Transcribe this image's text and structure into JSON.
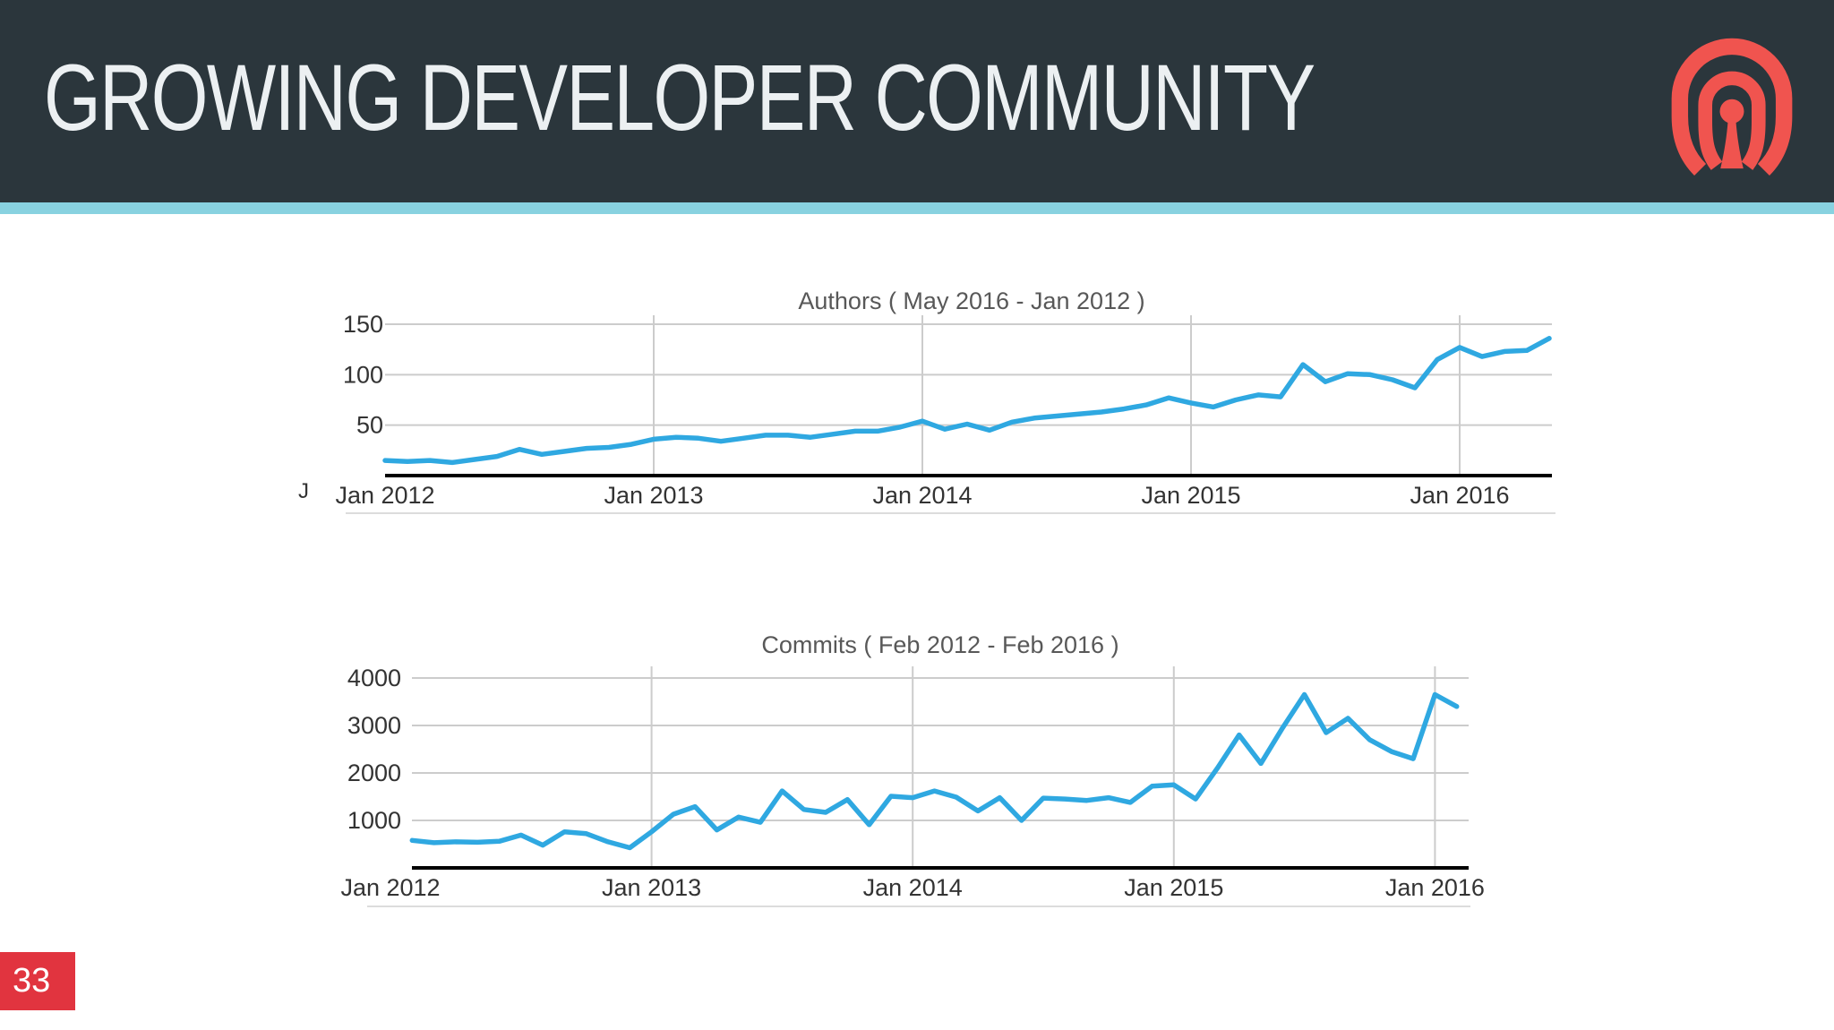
{
  "header": {
    "title": "GROWING DEVELOPER COMMUNITY"
  },
  "footer": {
    "page_number": "33"
  },
  "colors": {
    "header_bg": "#2B363C",
    "accent_teal": "#88D2E0",
    "page_badge_red": "#E1343F",
    "logo_coral": "#F0544F",
    "line_blue": "#2FA8E1",
    "gridline": "#CCCCCC",
    "axis": "#000000",
    "tick_text": "#333333",
    "chart_title_text": "#585858"
  },
  "chart_data": [
    {
      "type": "line",
      "title": "Authors ( May 2016 - Jan 2012 )",
      "xlabel": "",
      "ylabel": "",
      "grid": true,
      "legend": "none",
      "line_color": "#2FA8E1",
      "ylim": [
        0,
        158
      ],
      "y_ticks": [
        50,
        100,
        150
      ],
      "x_tick_labels": [
        "Jan 2012",
        "Jan 2013",
        "Jan 2014",
        "Jan 2015",
        "Jan 2016"
      ],
      "x_tick_data_indices": [
        0,
        12,
        24,
        36,
        48
      ],
      "stray_axis_label": "J",
      "x": [
        "Jan 2012",
        "Feb 2012",
        "Mar 2012",
        "Apr 2012",
        "May 2012",
        "Jun 2012",
        "Jul 2012",
        "Aug 2012",
        "Sep 2012",
        "Oct 2012",
        "Nov 2012",
        "Dec 2012",
        "Jan 2013",
        "Feb 2013",
        "Mar 2013",
        "Apr 2013",
        "May 2013",
        "Jun 2013",
        "Jul 2013",
        "Aug 2013",
        "Sep 2013",
        "Oct 2013",
        "Nov 2013",
        "Dec 2013",
        "Jan 2014",
        "Feb 2014",
        "Mar 2014",
        "Apr 2014",
        "May 2014",
        "Jun 2014",
        "Jul 2014",
        "Aug 2014",
        "Sep 2014",
        "Oct 2014",
        "Nov 2014",
        "Dec 2014",
        "Jan 2015",
        "Feb 2015",
        "Mar 2015",
        "Apr 2015",
        "May 2015",
        "Jun 2015",
        "Jul 2015",
        "Aug 2015",
        "Sep 2015",
        "Oct 2015",
        "Nov 2015",
        "Dec 2015",
        "Jan 2016",
        "Feb 2016",
        "Mar 2016",
        "Apr 2016",
        "May 2016"
      ],
      "series": [
        {
          "name": "Authors",
          "values": [
            15,
            14,
            15,
            13,
            16,
            19,
            26,
            21,
            24,
            27,
            28,
            31,
            36,
            38,
            37,
            34,
            37,
            40,
            40,
            38,
            41,
            44,
            44,
            48,
            54,
            46,
            51,
            45,
            53,
            57,
            59,
            61,
            63,
            66,
            70,
            77,
            72,
            68,
            75,
            80,
            78,
            110,
            93,
            101,
            100,
            95,
            87,
            115,
            127,
            118,
            123,
            124,
            136
          ]
        }
      ]
    },
    {
      "type": "line",
      "title": "Commits ( Feb 2012 - Feb 2016 )",
      "xlabel": "",
      "ylabel": "",
      "grid": true,
      "legend": "none",
      "line_color": "#2FA8E1",
      "ylim": [
        0,
        4200
      ],
      "y_ticks": [
        1000,
        2000,
        3000,
        4000
      ],
      "x_tick_labels": [
        "Jan 2012",
        "Jan 2013",
        "Jan 2014",
        "Jan 2015",
        "Jan 2016"
      ],
      "x_tick_data_indices": [
        -1,
        11,
        23,
        35,
        47
      ],
      "x": [
        "Feb 2012",
        "Mar 2012",
        "Apr 2012",
        "May 2012",
        "Jun 2012",
        "Jul 2012",
        "Aug 2012",
        "Sep 2012",
        "Oct 2012",
        "Nov 2012",
        "Dec 2012",
        "Jan 2013",
        "Feb 2013",
        "Mar 2013",
        "Apr 2013",
        "May 2013",
        "Jun 2013",
        "Jul 2013",
        "Aug 2013",
        "Sep 2013",
        "Oct 2013",
        "Nov 2013",
        "Dec 2013",
        "Jan 2014",
        "Feb 2014",
        "Mar 2014",
        "Apr 2014",
        "May 2014",
        "Jun 2014",
        "Jul 2014",
        "Aug 2014",
        "Sep 2014",
        "Oct 2014",
        "Nov 2014",
        "Dec 2014",
        "Jan 2015",
        "Feb 2015",
        "Mar 2015",
        "Apr 2015",
        "May 2015",
        "Jun 2015",
        "Jul 2015",
        "Aug 2015",
        "Sep 2015",
        "Oct 2015",
        "Nov 2015",
        "Dec 2015",
        "Jan 2016",
        "Feb 2016"
      ],
      "series": [
        {
          "name": "Commits",
          "values": [
            580,
            530,
            550,
            540,
            560,
            690,
            480,
            760,
            720,
            550,
            425,
            760,
            1130,
            1290,
            800,
            1070,
            960,
            1620,
            1230,
            1170,
            1440,
            910,
            1510,
            1480,
            1620,
            1490,
            1200,
            1480,
            1000,
            1470,
            1450,
            1420,
            1480,
            1380,
            1720,
            1750,
            1450,
            2100,
            2800,
            2200,
            2950,
            3650,
            2850,
            3150,
            2700,
            2450,
            2300,
            3650,
            3400
          ]
        }
      ]
    }
  ]
}
